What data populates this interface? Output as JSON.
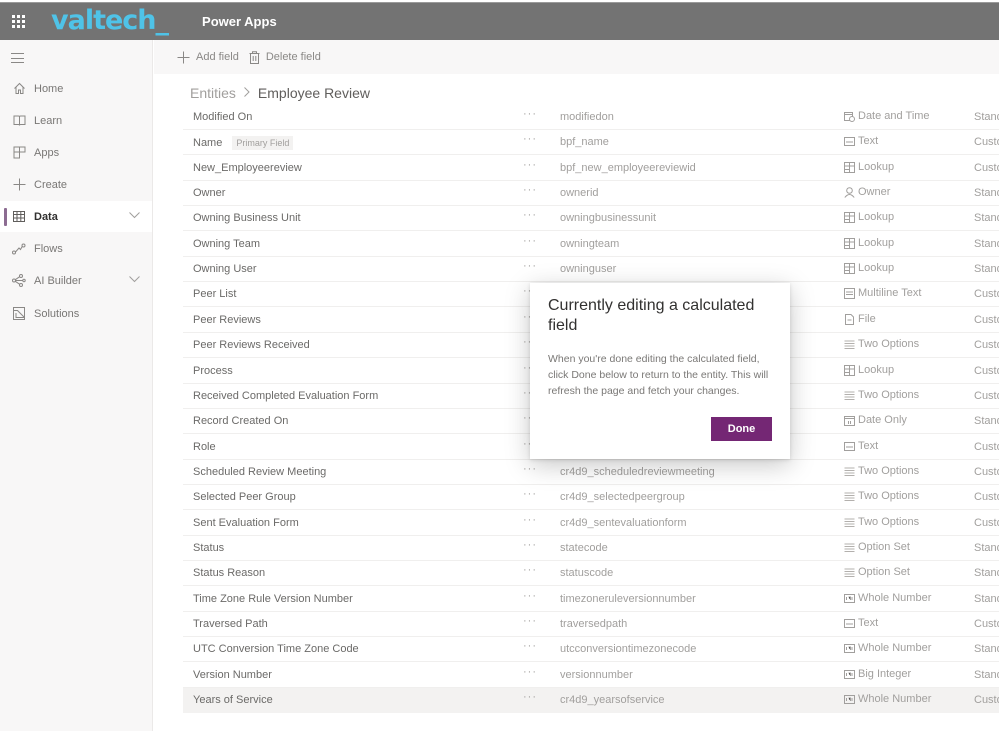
{
  "topbar": {
    "brand": "valtech_",
    "app_name": "Power Apps",
    "waffle_icon": "app-launcher-icon"
  },
  "sidebar": {
    "items": [
      {
        "label": "Home",
        "icon": "home-icon"
      },
      {
        "label": "Learn",
        "icon": "book-icon"
      },
      {
        "label": "Apps",
        "icon": "apps-icon"
      },
      {
        "label": "Create",
        "icon": "plus-icon"
      },
      {
        "label": "Data",
        "icon": "table-icon",
        "active": true,
        "expandable": true
      },
      {
        "label": "Flows",
        "icon": "flow-icon"
      },
      {
        "label": "AI Builder",
        "icon": "ai-builder-icon",
        "expandable": true
      },
      {
        "label": "Solutions",
        "icon": "solutions-icon"
      }
    ]
  },
  "commandbar": {
    "add_field": "Add field",
    "delete_field": "Delete field"
  },
  "breadcrumb": {
    "root": "Entities",
    "separator": ">",
    "current": "Employee Review"
  },
  "fields": [
    {
      "name": "Modified On",
      "schema": "modifiedon",
      "type": "Date and Time",
      "type_icon": "datetime-icon",
      "kind": "Standard"
    },
    {
      "name": "Name",
      "badge": "Primary Field",
      "schema": "bpf_name",
      "type": "Text",
      "type_icon": "text-icon",
      "kind": "Custom"
    },
    {
      "name": "New_Employeereview",
      "schema": "bpf_new_employeereviewid",
      "type": "Lookup",
      "type_icon": "lookup-icon",
      "kind": "Custom"
    },
    {
      "name": "Owner",
      "schema": "ownerid",
      "type": "Owner",
      "type_icon": "person-icon",
      "kind": "Standard"
    },
    {
      "name": "Owning Business Unit",
      "schema": "owningbusinessunit",
      "type": "Lookup",
      "type_icon": "lookup-icon",
      "kind": "Standard"
    },
    {
      "name": "Owning Team",
      "schema": "owningteam",
      "type": "Lookup",
      "type_icon": "lookup-icon",
      "kind": "Standard"
    },
    {
      "name": "Owning User",
      "schema": "owninguser",
      "type": "Lookup",
      "type_icon": "lookup-icon",
      "kind": "Standard"
    },
    {
      "name": "Peer List",
      "schema": "",
      "type": "Multiline Text",
      "type_icon": "multiline-text-icon",
      "kind": "Custom"
    },
    {
      "name": "Peer Reviews",
      "schema": "",
      "type": "File",
      "type_icon": "file-icon",
      "kind": "Custom"
    },
    {
      "name": "Peer Reviews Received",
      "schema": "",
      "type": "Two Options",
      "type_icon": "options-icon",
      "kind": "Custom"
    },
    {
      "name": "Process",
      "schema": "",
      "type": "Lookup",
      "type_icon": "lookup-icon",
      "kind": "Custom"
    },
    {
      "name": "Received Completed Evaluation Form",
      "schema": "",
      "type": "Two Options",
      "type_icon": "options-icon",
      "kind": "Custom"
    },
    {
      "name": "Record Created On",
      "schema": "",
      "type": "Date Only",
      "type_icon": "date-icon",
      "kind": "Standard"
    },
    {
      "name": "Role",
      "schema": "",
      "type": "Text",
      "type_icon": "text-icon",
      "kind": "Custom"
    },
    {
      "name": "Scheduled Review Meeting",
      "schema": "cr4d9_scheduledreviewmeeting",
      "type": "Two Options",
      "type_icon": "options-icon",
      "kind": "Custom"
    },
    {
      "name": "Selected Peer Group",
      "schema": "cr4d9_selectedpeergroup",
      "type": "Two Options",
      "type_icon": "options-icon",
      "kind": "Custom"
    },
    {
      "name": "Sent Evaluation Form",
      "schema": "cr4d9_sentevaluationform",
      "type": "Two Options",
      "type_icon": "options-icon",
      "kind": "Custom"
    },
    {
      "name": "Status",
      "schema": "statecode",
      "type": "Option Set",
      "type_icon": "options-icon",
      "kind": "Standard"
    },
    {
      "name": "Status Reason",
      "schema": "statuscode",
      "type": "Option Set",
      "type_icon": "options-icon",
      "kind": "Standard"
    },
    {
      "name": "Time Zone Rule Version Number",
      "schema": "timezoneruleversionnumber",
      "type": "Whole Number",
      "type_icon": "number-icon",
      "kind": "Standard"
    },
    {
      "name": "Traversed Path",
      "schema": "traversedpath",
      "type": "Text",
      "type_icon": "text-icon",
      "kind": "Custom"
    },
    {
      "name": "UTC Conversion Time Zone Code",
      "schema": "utcconversiontimezonecode",
      "type": "Whole Number",
      "type_icon": "number-icon",
      "kind": "Standard"
    },
    {
      "name": "Version Number",
      "schema": "versionnumber",
      "type": "Big Integer",
      "type_icon": "number-icon",
      "kind": "Standard"
    },
    {
      "name": "Years of Service",
      "schema": "cr4d9_yearsofservice",
      "type": "Whole Number",
      "type_icon": "number-icon",
      "kind": "Custom",
      "selected": true
    }
  ],
  "more_label": "···",
  "dialog": {
    "title": "Currently editing a calculated field",
    "body": "When you're done editing the calculated field, click Done below to return to the entity. This will refresh the page and fetch your changes.",
    "done_label": "Done"
  },
  "colors": {
    "topbar": "#737373",
    "brand": "#4fc3e8",
    "accent": "#742774",
    "nav_indicator": "#8c6c92"
  }
}
